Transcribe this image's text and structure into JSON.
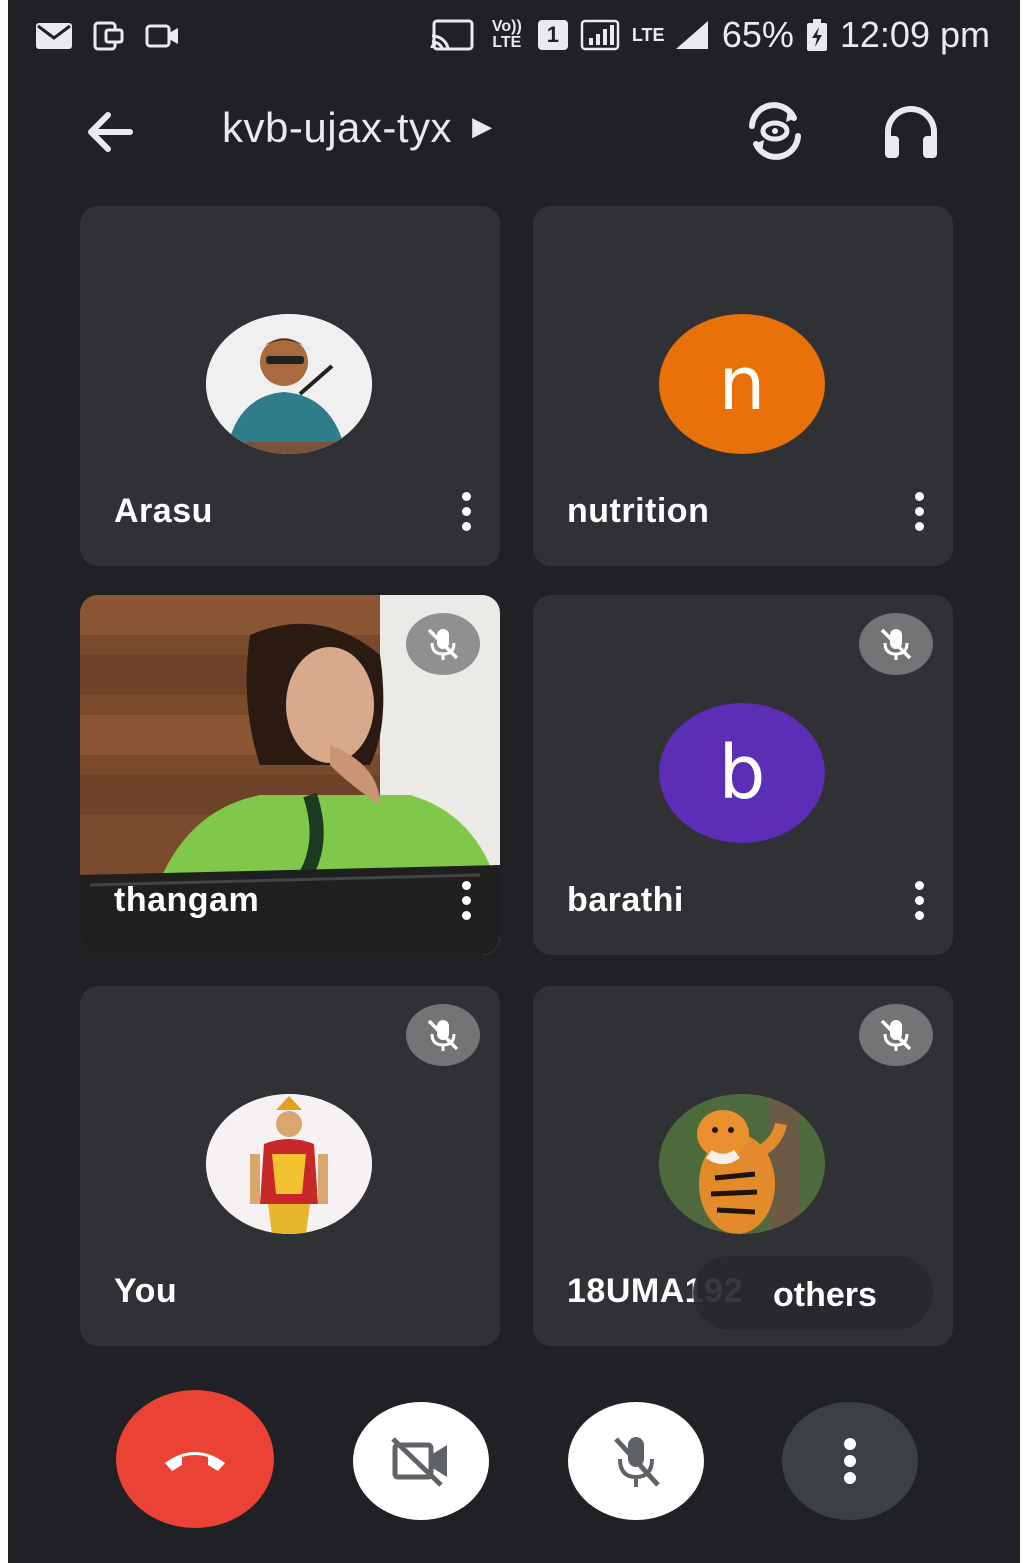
{
  "status_bar": {
    "battery": "65%",
    "time": "12:09 pm",
    "volte_label": "Vo)) LTE",
    "sim_label": "1",
    "lte_label": "LTE"
  },
  "meeting": {
    "code": "kvb-ujax-tyx"
  },
  "participants": [
    {
      "name": "Arasu",
      "avatar_type": "photo",
      "muted": false
    },
    {
      "name": "nutrition",
      "avatar_type": "letter",
      "letter": "n",
      "color": "#e8710a",
      "muted": false
    },
    {
      "name": "thangam",
      "avatar_type": "video",
      "muted": true
    },
    {
      "name": "barathi",
      "avatar_type": "letter",
      "letter": "b",
      "color": "#5c2db5",
      "muted": true
    },
    {
      "name": "You",
      "avatar_type": "photo",
      "muted": true
    },
    {
      "name": "18UMA192",
      "avatar_type": "photo",
      "muted": true,
      "overlay": "others"
    }
  ],
  "controls": {
    "end_call_color": "#ea4335",
    "more_bg": "#3c4043"
  }
}
